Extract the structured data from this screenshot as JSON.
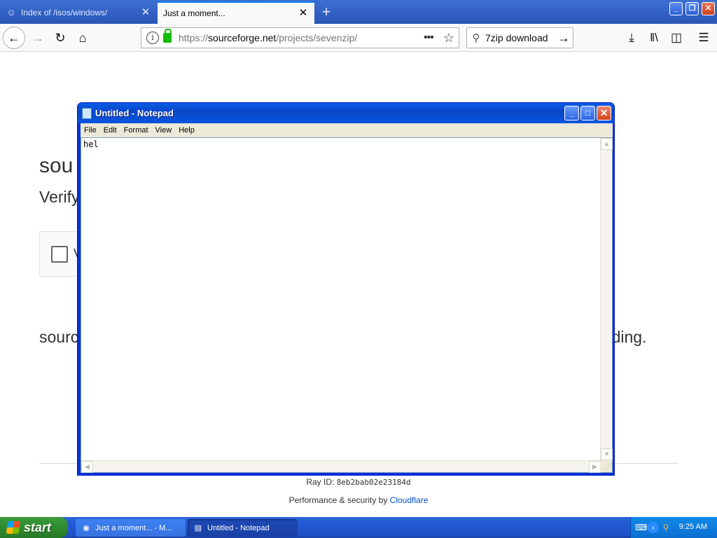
{
  "browser": {
    "tabs": [
      {
        "label": "Index of /isos/windows/",
        "active": false
      },
      {
        "label": "Just a moment...",
        "active": true
      }
    ],
    "url_prefix": "https://",
    "url_domain": "sourceforge.net",
    "url_path": "/projects/sevenzip/",
    "search_value": "7zip download"
  },
  "page": {
    "site_title": "sou",
    "verify_text": "Verify",
    "checkbox_label": "V",
    "review_text_start": "sourc",
    "review_text_end": "eeding.",
    "ray_label": "Ray ID: ",
    "ray_id": "8eb2bab02e23184d",
    "perf_text": "Performance & security by ",
    "perf_link": "Cloudflare"
  },
  "notepad": {
    "title": "Untitled - Notepad",
    "menu": [
      "File",
      "Edit",
      "Format",
      "View",
      "Help"
    ],
    "content": "hel"
  },
  "taskbar": {
    "start_label": "start",
    "tasks": [
      {
        "label": "Just a moment... - M..."
      },
      {
        "label": "Untitled - Notepad"
      }
    ],
    "clock": "9:25 AM"
  },
  "colors": {
    "xp_title_blue": "#0a5ce6",
    "start_green": "#2f8a2f",
    "firefox_accent": "#0a84ff",
    "cloudflare_link": "#0051c3"
  }
}
